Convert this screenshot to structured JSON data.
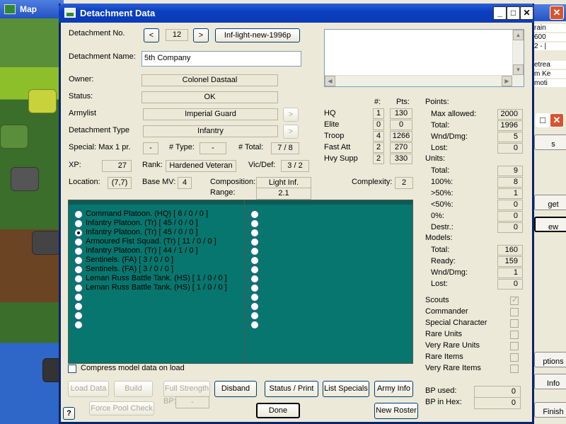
{
  "bg_map": {
    "title": "Map"
  },
  "bg_right": {
    "snippets": [
      "rain",
      "600",
      "2 - |",
      "etrea",
      "m Ke",
      "moti"
    ],
    "buttons": [
      "s",
      "",
      "get",
      "ew",
      "",
      "",
      "",
      "",
      "",
      "",
      "ptions",
      "Info",
      "Finish"
    ]
  },
  "dialog": {
    "title": "Detachment Data",
    "controls": {
      "minimize": "_",
      "maximize": "□",
      "close": "✕"
    }
  },
  "detachment": {
    "no_label": "Detachment No.",
    "prev": "<",
    "number": "12",
    "next": ">",
    "preset": "Inf-light-new-1996p",
    "name_label": "Detachment Name:",
    "name": "5th Company",
    "owner_label": "Owner:",
    "owner": "Colonel Dastaal",
    "status_label": "Status:",
    "status": "OK",
    "armylist_label": "Armylist",
    "armylist": "Imperial Guard",
    "armylist_btn": ">",
    "type_label": "Detachment Type",
    "type": "Infantry",
    "type_btn": ">",
    "special_label": "Special: Max 1 pr.",
    "special_value": "-",
    "num_type_label": "# Type:",
    "num_type_value": "-",
    "num_total_label": "# Total:",
    "num_total_value": "7 / 8",
    "xp_label": "XP:",
    "xp": "27",
    "rank_label": "Rank:",
    "rank": "Hardened Veteran",
    "vicdef_label": "Vic/Def:",
    "vicdef": "3 / 2",
    "location_label": "Location:",
    "location": "(7,7)",
    "basemv_label": "Base MV:",
    "basemv": "4",
    "composition_label": "Composition:",
    "composition": "Light Inf.",
    "range_label": "Range:",
    "range": "2.1",
    "complexity_label": "Complexity:",
    "complexity": "2"
  },
  "points_table": {
    "col_num": "#:",
    "col_pts": "Pts:",
    "rows": [
      {
        "label": "HQ",
        "num": "1",
        "pts": "130"
      },
      {
        "label": "Elite",
        "num": "0",
        "pts": "0"
      },
      {
        "label": "Troop",
        "num": "4",
        "pts": "1266"
      },
      {
        "label": "Fast Att",
        "num": "2",
        "pts": "270"
      },
      {
        "label": "Hvy Supp",
        "num": "2",
        "pts": "330"
      }
    ]
  },
  "stats": {
    "points_header": "Points:",
    "points": [
      {
        "label": "Max allowed:",
        "value": "2000"
      },
      {
        "label": "Total:",
        "value": "1996"
      },
      {
        "label": "Wnd/Dmg:",
        "value": "5"
      },
      {
        "label": "Lost:",
        "value": "0"
      }
    ],
    "units_header": "Units:",
    "units": [
      {
        "label": "Total:",
        "value": "9"
      },
      {
        "label": "100%:",
        "value": "8"
      },
      {
        "label": ">50%:",
        "value": "1"
      },
      {
        "label": "<50%:",
        "value": "0"
      },
      {
        "label": "0%:",
        "value": "0"
      },
      {
        "label": "Destr.:",
        "value": "0"
      }
    ],
    "models_header": "Models:",
    "models": [
      {
        "label": "Total:",
        "value": "160"
      },
      {
        "label": "Ready:",
        "value": "159"
      },
      {
        "label": "Wnd/Dmg:",
        "value": "1"
      },
      {
        "label": "Lost:",
        "value": "0"
      }
    ]
  },
  "flags": [
    {
      "label": "Scouts",
      "checked": true
    },
    {
      "label": "Commander",
      "checked": false
    },
    {
      "label": "Special Character",
      "checked": false
    },
    {
      "label": "Rare Units",
      "checked": false
    },
    {
      "label": "Very Rare Units",
      "checked": false
    },
    {
      "label": "Rare Items",
      "checked": false
    },
    {
      "label": "Very Rare Items",
      "checked": false
    }
  ],
  "units_list": [
    "Command Platoon. (HQ) [ 6 / 0 / 0 ]",
    "Infantry Platoon. (Tr) [ 45 / 0 / 0 ]",
    "Infantry Platoon. (Tr) [ 45 / 0 / 0 ]",
    "Armoured Fist Squad. (Tr) [ 11 / 0 / 0 ]",
    "Infantry Platoon. (Tr) [ 44 / 1 / 0 ]",
    "Sentinels. (FA) [ 3 / 0 / 0 ]",
    "Sentinels. (FA) [ 3 / 0 / 0 ]",
    "Leman Russ Battle Tank. (HS) [ 1 / 0 / 0 ]",
    "Leman Russ Battle Tank. (HS) [ 1 / 0 / 0 ]"
  ],
  "selected_unit_index": 2,
  "compress_label": "Compress model data on load",
  "bp": {
    "used_label": "BP used:",
    "used": "0",
    "hex_label": "BP in Hex:",
    "hex": "0",
    "small_label": "BP:",
    "small_value": "-"
  },
  "buttons": {
    "load_data": "Load Data",
    "build": "Build",
    "full_strength": "Full Strength",
    "disband": "Disband",
    "status_print": "Status / Print",
    "list_specials": "List Specials",
    "army_info": "Army Info",
    "force_pool_check": "Force Pool Check",
    "done": "Done",
    "new_roster": "New Roster",
    "help": "?"
  }
}
